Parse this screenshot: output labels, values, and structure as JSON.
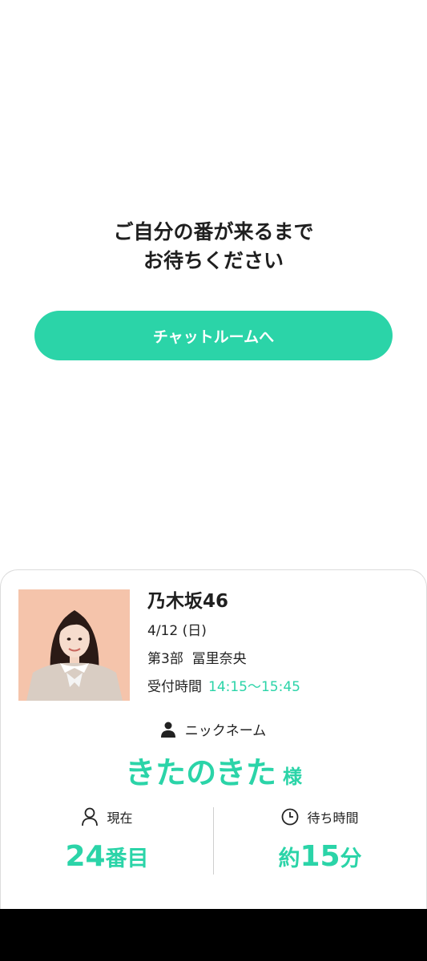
{
  "waiting": {
    "message_line1": "ご自分の番が来るまで",
    "message_line2": "お待ちください"
  },
  "chat_button_label": "チャットルームへ",
  "event": {
    "group_name": "乃木坂46",
    "date": "4/12 (日)",
    "session": "第3部",
    "member": "冨里奈央",
    "reception_label": "受付時間",
    "reception_time": "14:15〜15:45"
  },
  "nickname": {
    "label": "ニックネーム",
    "value": "きたのきた",
    "suffix": "様",
    "icon": "person-icon"
  },
  "current": {
    "label": "現在",
    "number": "24",
    "unit": "番目",
    "icon": "user-outline-icon"
  },
  "wait": {
    "label": "待ち時間",
    "prefix": "約",
    "number": "15",
    "unit": "分",
    "icon": "clock-icon"
  },
  "colors": {
    "accent": "#2bd4a8",
    "text": "#222222",
    "photo_background": "#f5c4ab",
    "bottom_bar": "#000000"
  }
}
